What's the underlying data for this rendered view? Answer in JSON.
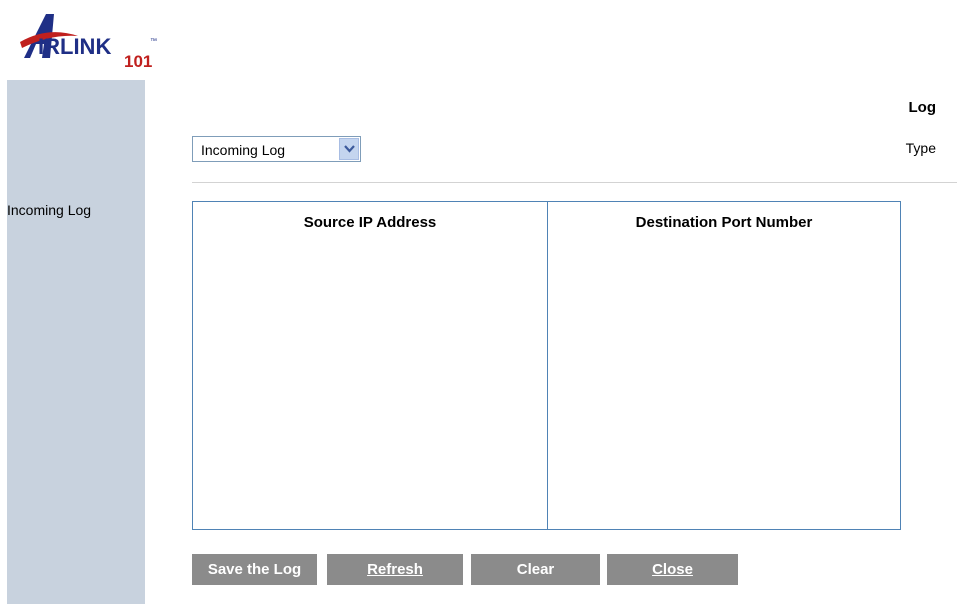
{
  "brand": {
    "logo_text": "IRLINK",
    "logo_number": "101",
    "logo_tm": "™",
    "colors": {
      "primary": "#1f2f86",
      "accent": "#c0201e"
    }
  },
  "sidebar": {
    "title": "Log",
    "type_label": "Type",
    "incoming_label": "Incoming Log",
    "background": "#c8d2de"
  },
  "filter": {
    "selected": "Incoming Log",
    "icon": "chevron-down-icon"
  },
  "table": {
    "headers": [
      "Source IP Address",
      "Destination Port Number"
    ],
    "rows": []
  },
  "buttons": {
    "save": "Save the Log",
    "refresh": "Refresh",
    "clear": "Clear",
    "close": "Close"
  }
}
